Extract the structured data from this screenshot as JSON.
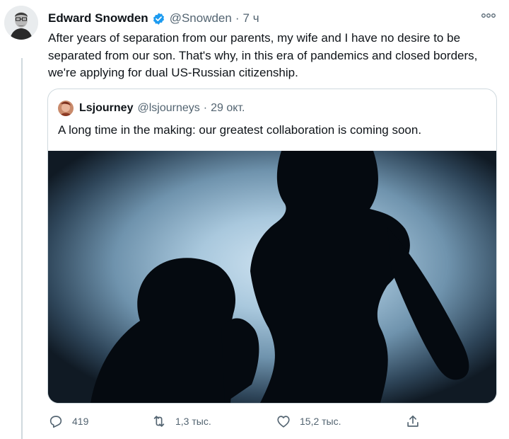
{
  "tweet": {
    "author_name": "Edward Snowden",
    "author_handle": "@Snowden",
    "separator": "·",
    "time": "7 ч",
    "text": "After years of separation from our parents, my wife and I have no desire to be separated from our son. That's why, in this era of pandemics and closed borders, we're applying for dual US-Russian citizenship.",
    "verified": true,
    "colors": {
      "verified": "#1d9bf0",
      "secondary_text": "#536471",
      "border": "#cfd9de"
    }
  },
  "quoted_tweet": {
    "author_name": "Lsjourney",
    "author_handle": "@lsjourneys",
    "separator": "·",
    "time": "29 окт.",
    "text": "A long time in the making: our greatest collaboration is coming soon.",
    "media_icon": "silhouette-photo"
  },
  "actions": {
    "reply": {
      "icon": "reply-icon",
      "count": "419"
    },
    "retweet": {
      "icon": "retweet-icon",
      "count": "1,3 тыс."
    },
    "like": {
      "icon": "heart-icon",
      "count": "15,2 тыс."
    },
    "share": {
      "icon": "share-icon"
    }
  }
}
